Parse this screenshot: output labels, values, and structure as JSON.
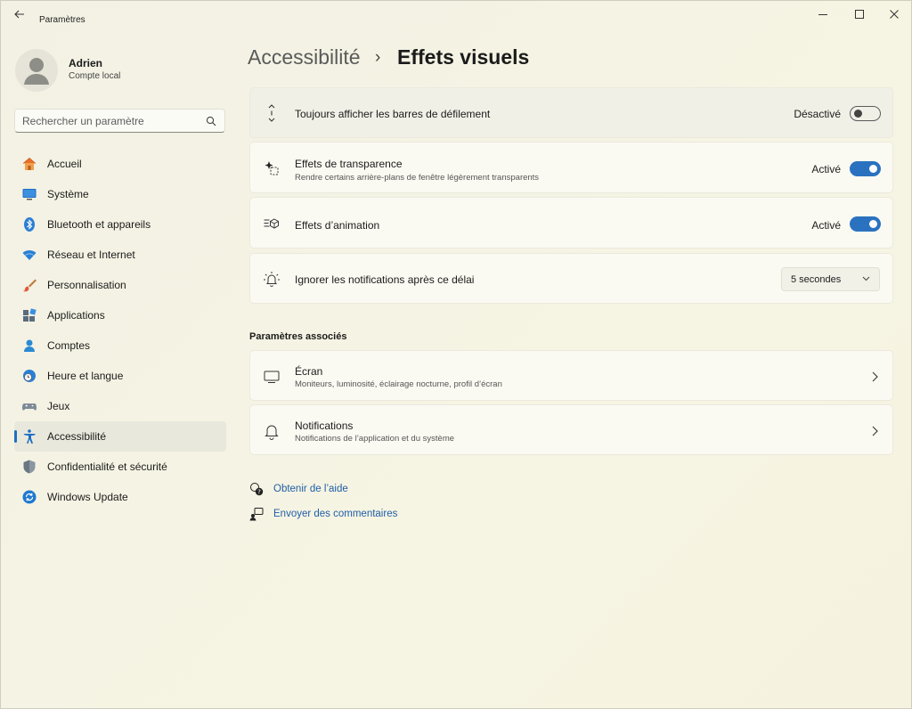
{
  "window": {
    "app_title": "Paramètres"
  },
  "user": {
    "name": "Adrien",
    "account_type": "Compte local"
  },
  "search": {
    "placeholder": "Rechercher un paramètre"
  },
  "sidebar": {
    "items": [
      {
        "label": "Accueil",
        "icon": "home-icon"
      },
      {
        "label": "Système",
        "icon": "monitor-icon"
      },
      {
        "label": "Bluetooth et appareils",
        "icon": "bluetooth-icon"
      },
      {
        "label": "Réseau et Internet",
        "icon": "wifi-icon"
      },
      {
        "label": "Personnalisation",
        "icon": "brush-icon"
      },
      {
        "label": "Applications",
        "icon": "apps-icon"
      },
      {
        "label": "Comptes",
        "icon": "person-icon"
      },
      {
        "label": "Heure et langue",
        "icon": "clock-globe-icon"
      },
      {
        "label": "Jeux",
        "icon": "gamepad-icon"
      },
      {
        "label": "Accessibilité",
        "icon": "accessibility-icon",
        "active": true
      },
      {
        "label": "Confidentialité et sécurité",
        "icon": "shield-icon"
      },
      {
        "label": "Windows Update",
        "icon": "update-icon"
      }
    ]
  },
  "breadcrumb": {
    "parent": "Accessibilité",
    "separator": "›",
    "current": "Effets visuels"
  },
  "settings": {
    "scrollbars": {
      "title": "Toujours afficher les barres de défilement",
      "state": "Désactivé",
      "on": false
    },
    "transparency": {
      "title": "Effets de transparence",
      "subtitle": "Rendre certains arrière-plans de fenêtre légèrement transparents",
      "state": "Activé",
      "on": true
    },
    "animation": {
      "title": "Effets d’animation",
      "state": "Activé",
      "on": true
    },
    "notifications_timeout": {
      "title": "Ignorer les notifications après ce délai",
      "selected": "5 secondes"
    }
  },
  "related": {
    "heading": "Paramètres associés",
    "items": [
      {
        "title": "Écran",
        "subtitle": "Moniteurs, luminosité, éclairage nocturne, profil d’écran"
      },
      {
        "title": "Notifications",
        "subtitle": "Notifications de l’application et du système"
      }
    ]
  },
  "links": {
    "help": "Obtenir de l’aide",
    "feedback": "Envoyer des commentaires"
  },
  "colors": {
    "accent": "#2a72c0",
    "link": "#1f5fa8"
  }
}
